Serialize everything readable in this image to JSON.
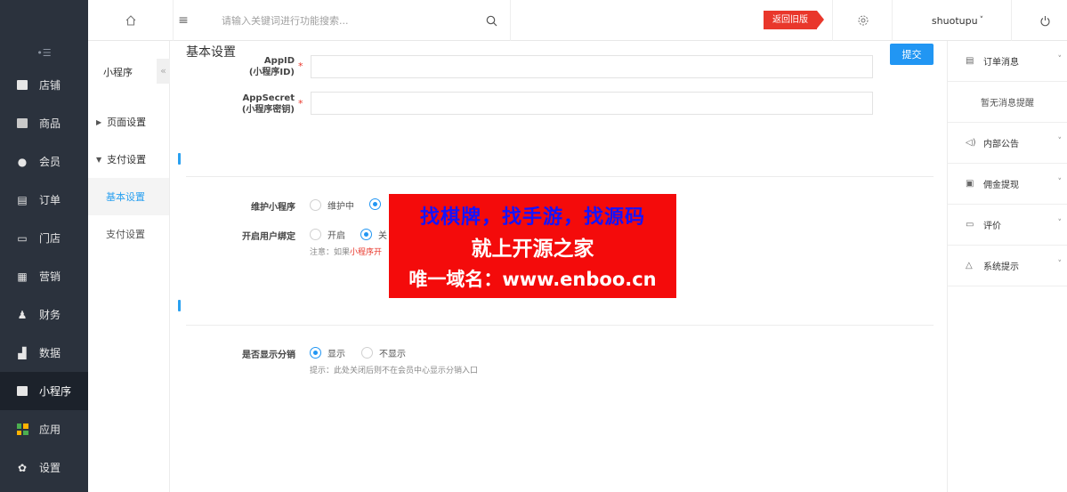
{
  "sidebar": {
    "toggle_icon": "collapse-icon",
    "items": [
      {
        "label": "店铺",
        "icon": "store-icon"
      },
      {
        "label": "商品",
        "icon": "goods-icon"
      },
      {
        "label": "会员",
        "icon": "member-icon"
      },
      {
        "label": "订单",
        "icon": "order-icon"
      },
      {
        "label": "门店",
        "icon": "shop-icon"
      },
      {
        "label": "营销",
        "icon": "marketing-icon"
      },
      {
        "label": "财务",
        "icon": "finance-icon"
      },
      {
        "label": "数据",
        "icon": "data-icon"
      },
      {
        "label": "小程序",
        "icon": "miniprogram-icon",
        "active": true
      },
      {
        "label": "应用",
        "icon": "apps-icon"
      },
      {
        "label": "设置",
        "icon": "settings-icon"
      }
    ]
  },
  "topbar": {
    "search_placeholder": "请输入关键词进行功能搜索...",
    "back_label": "返回旧版",
    "username": "shuotupu",
    "user_chevron": "˅"
  },
  "subnav": {
    "title": "小程序",
    "collapse_glyph": "«",
    "groups": [
      {
        "label": "页面设置",
        "expanded": false
      },
      {
        "label": "支付设置",
        "expanded": true
      }
    ],
    "links": [
      {
        "label": "基本设置",
        "active": true
      },
      {
        "label": "支付设置",
        "active": false
      }
    ]
  },
  "main": {
    "title": "基本设置",
    "submit_label": "提交",
    "appid_label": "AppID",
    "appid_sub": "(小程序ID)",
    "appsecret_label": "AppSecret",
    "appsecret_sub": "(小程序密钥)",
    "required_mark": "*",
    "maintain_label": "维护小程序",
    "maintain_on": "维护中",
    "bind_label": "开启用户绑定",
    "bind_on": "开启",
    "bind_off": "关",
    "bind_note_prefix": "注意：如果",
    "bind_note_link": "小程序开",
    "show_label": "是否显示分销",
    "show_yes": "显示",
    "show_no": "不显示",
    "show_hint": "提示：此处关闭后则不在会员中心显示分销入口"
  },
  "banner": {
    "line1": "找棋牌，找手游，找源码",
    "line2": "就上开源之家",
    "line3": "唯一域名：www.enboo.cn"
  },
  "rpanel": {
    "items": [
      {
        "label": "订单消息",
        "icon": "order-msg-icon",
        "glyph": "▤"
      },
      {
        "label": "内部公告",
        "icon": "speaker-icon",
        "glyph": "◁)"
      },
      {
        "label": "佣金提现",
        "icon": "withdraw-icon",
        "glyph": "▣"
      },
      {
        "label": "评价",
        "icon": "comment-icon",
        "glyph": "▭"
      },
      {
        "label": "系统提示",
        "icon": "bell-icon",
        "glyph": "△"
      }
    ],
    "empty_text": "暂无消息提醒",
    "chevron": "˅"
  },
  "colors": {
    "sidebar_bg": "#2b323d",
    "accent": "#2196f3",
    "danger": "#e9372b",
    "banner_bg": "#f40b0b",
    "banner_text_blue": "#1414ff"
  }
}
